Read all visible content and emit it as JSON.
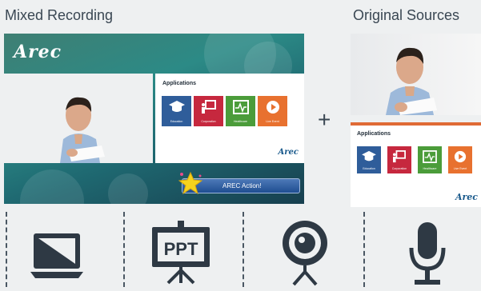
{
  "headings": {
    "mixed": "Mixed Recording",
    "original": "Original Sources"
  },
  "logo": "Arec",
  "slide": {
    "title": "Applications",
    "tiles": [
      {
        "label": "Education",
        "icon": "graduation-cap-icon",
        "color": "#2f5d9a"
      },
      {
        "label": "Corporation",
        "icon": "presenter-board-icon",
        "color": "#c6283e"
      },
      {
        "label": "Healthcare",
        "icon": "heartbeat-monitor-icon",
        "color": "#4b9c3a"
      },
      {
        "label": "Live Event",
        "icon": "play-circle-icon",
        "color": "#e8712f"
      }
    ],
    "brand": "Arec"
  },
  "badge": {
    "text": "AREC Action!",
    "icon": "star-icon"
  },
  "plus": "+",
  "inputs": [
    {
      "name": "laptop-icon"
    },
    {
      "name": "ppt-projector-icon",
      "text": "PPT"
    },
    {
      "name": "webcam-icon"
    },
    {
      "name": "microphone-icon"
    }
  ],
  "colors": {
    "heading": "#3a4753",
    "icon": "#2e3944",
    "accent": "#1a5a8c"
  }
}
